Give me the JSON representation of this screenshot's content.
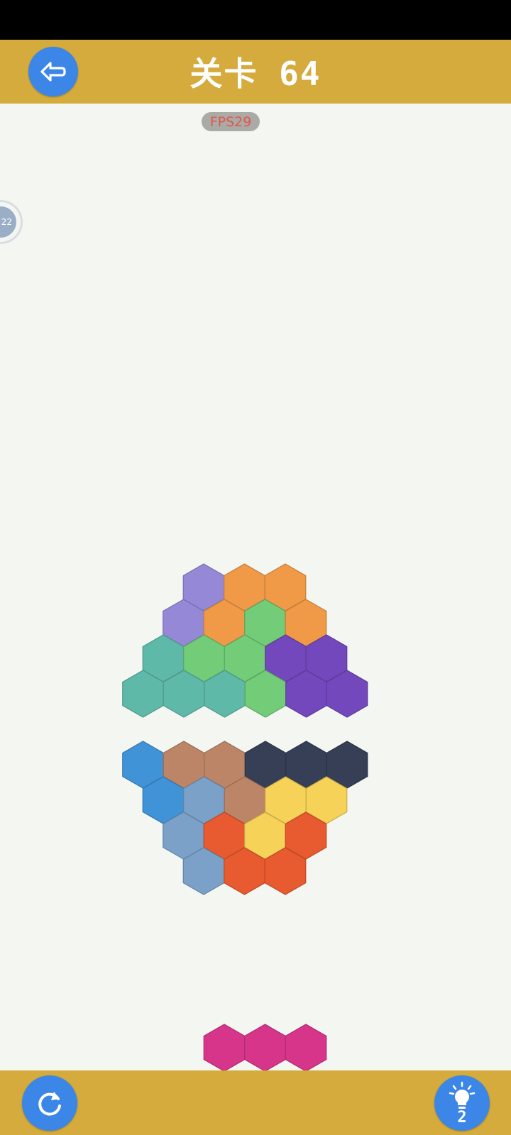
{
  "header": {
    "title": "关卡 64",
    "back_icon": "back-arrow-icon",
    "bg_color": "#d4ab3c"
  },
  "fps": {
    "label": "FPS29"
  },
  "side_badge": {
    "value": "22"
  },
  "footer": {
    "reset_icon": "refresh-icon",
    "hint_icon": "lightbulb-icon",
    "hint_count": "2"
  },
  "colors": {
    "lavender": "#9588d6",
    "orange": "#f09a48",
    "green": "#72cc78",
    "teal": "#5fb9a8",
    "purple": "#7348bd",
    "blue": "#3f93d6",
    "brown": "#bd8567",
    "navy": "#363f55",
    "steel": "#7ba1c9",
    "yellow": "#f6d258",
    "red": "#e85a30",
    "magenta": "#d73589"
  },
  "board": {
    "upper_rows": [
      [
        "lavender",
        "orange",
        "orange"
      ],
      [
        "lavender",
        "orange",
        "green",
        "orange"
      ],
      [
        "teal",
        "green",
        "green",
        "purple",
        "purple"
      ],
      [
        "teal",
        "teal",
        "teal",
        "green",
        "purple",
        "purple"
      ]
    ],
    "lower_rows": [
      [
        "blue",
        "brown",
        "brown",
        "navy",
        "navy",
        "navy"
      ],
      [
        "blue",
        "steel",
        "brown",
        "yellow",
        "yellow"
      ],
      [
        "steel",
        "red",
        "yellow",
        "red"
      ],
      [
        "steel",
        "red",
        "red"
      ]
    ],
    "tray_piece": [
      "magenta",
      "magenta",
      "magenta"
    ]
  }
}
